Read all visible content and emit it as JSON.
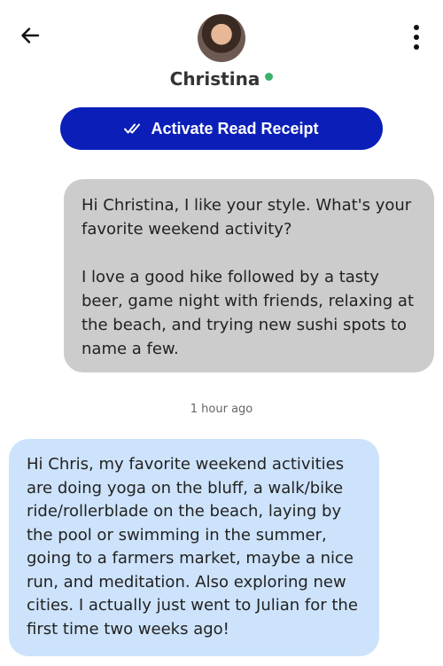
{
  "header": {
    "contact_name": "Christina",
    "online_color": "#3cb06b",
    "back_icon": "arrow-left-icon",
    "menu_icon": "more-vertical-icon"
  },
  "read_receipt": {
    "label": "Activate Read Receipt",
    "icon": "double-check-icon",
    "color": "#0b1fb8"
  },
  "messages": [
    {
      "direction": "sent",
      "paragraphs": [
        "Hi Christina, I like your style. What's your favorite weekend activity?",
        "I love a good hike followed by a tasty beer, game night with friends, relaxing at the beach, and trying new sushi spots to name a few."
      ]
    },
    {
      "direction": "received",
      "timestamp": "1 hour ago",
      "paragraphs": [
        "Hi Chris, my favorite weekend activities are doing yoga on the bluff, a walk/bike ride/rollerblade on the beach, laying by the pool or swimming in the summer, going to a farmers market, maybe a nice run, and meditation. Also exploring new cities. I actually just went to Julian for the first time two weeks ago!"
      ]
    }
  ]
}
